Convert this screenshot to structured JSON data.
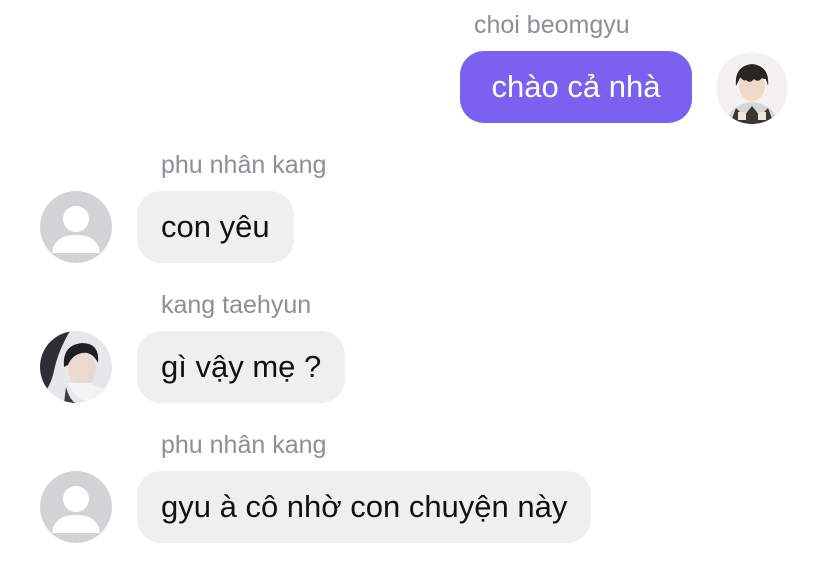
{
  "conversation": {
    "messages": [
      {
        "sender": "choi beomgyu",
        "text": "chào cả nhà",
        "direction": "outgoing",
        "avatar": "photo-avatar"
      },
      {
        "sender": "phu nhân kang",
        "text": "con yêu",
        "direction": "incoming",
        "avatar": "default-user-icon"
      },
      {
        "sender": "kang taehyun",
        "text": "gì vậy mẹ ?",
        "direction": "incoming",
        "avatar": "photo-avatar"
      },
      {
        "sender": "phu nhân kang",
        "text": "gyu à cô nhờ con chuyện này",
        "direction": "incoming",
        "avatar": "default-user-icon"
      }
    ]
  },
  "colors": {
    "outgoing_bubble": "#7b61f0",
    "incoming_bubble": "#efeff0",
    "sender_name": "#8e8e93",
    "default_avatar_bg": "#d3d3d6"
  }
}
